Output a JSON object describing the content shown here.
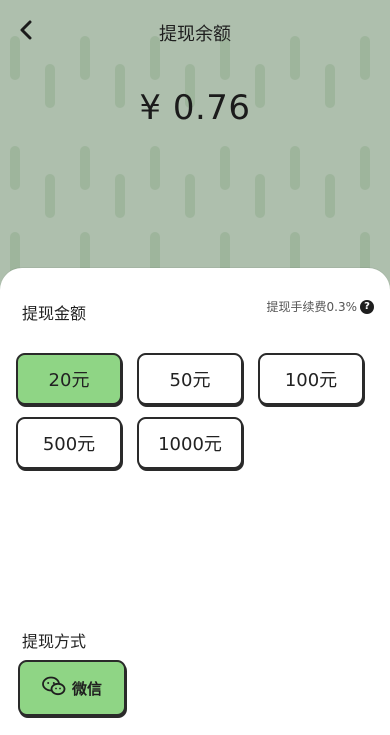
{
  "header": {
    "title": "提现余额"
  },
  "balance": {
    "display": "¥ 0.76"
  },
  "amount_section": {
    "label": "提现金额",
    "fee_note": "提现手续费0.3%",
    "options": [
      {
        "label": "20元",
        "selected": true
      },
      {
        "label": "50元",
        "selected": false
      },
      {
        "label": "100元",
        "selected": false
      },
      {
        "label": "500元",
        "selected": false
      },
      {
        "label": "1000元",
        "selected": false
      }
    ]
  },
  "method_section": {
    "label": "提现方式",
    "options": [
      {
        "label": "微信",
        "icon": "wechat-icon",
        "selected": true
      }
    ]
  },
  "colors": {
    "accent": "#8fd585",
    "background": "#aebfad",
    "stripe": "#9eb59c"
  }
}
